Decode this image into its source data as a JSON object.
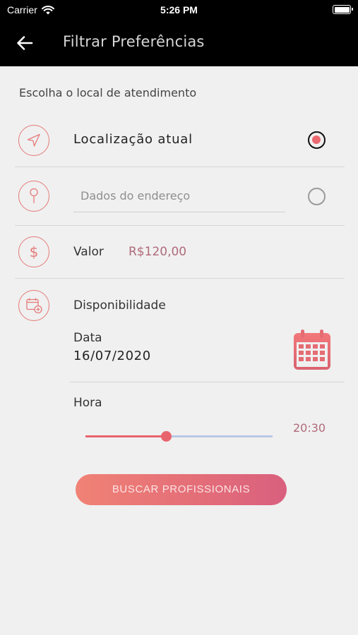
{
  "status_bar": {
    "carrier": "Carrier",
    "time": "5:26 PM"
  },
  "header": {
    "title": "Filtrar Preferências",
    "back_icon": "arrow-left-icon"
  },
  "location_section": {
    "label": "Escolha o local de atendimento",
    "current_location": {
      "label": "Localização atual",
      "selected": true,
      "icon": "navigation-arrow-icon"
    },
    "address": {
      "placeholder": "Dados do endereço",
      "selected": false,
      "icon": "map-pin-icon"
    }
  },
  "value": {
    "label": "Valor",
    "amount": "R$120,00",
    "icon": "dollar-icon"
  },
  "availability": {
    "label": "Disponibilidade",
    "icon": "calendar-add-icon",
    "date_label": "Data",
    "date_value": "16/07/2020",
    "calendar_icon": "calendar-icon",
    "time_label": "Hora",
    "time_value": "20:30",
    "slider_fraction": 0.43
  },
  "search_button": {
    "label": "BUSCAR PROFISSIONAIS"
  },
  "colors": {
    "accent": "#ea6870",
    "header_bg": "#000000",
    "background": "#f0f0f0",
    "slider_rest": "#b9c8e6"
  }
}
